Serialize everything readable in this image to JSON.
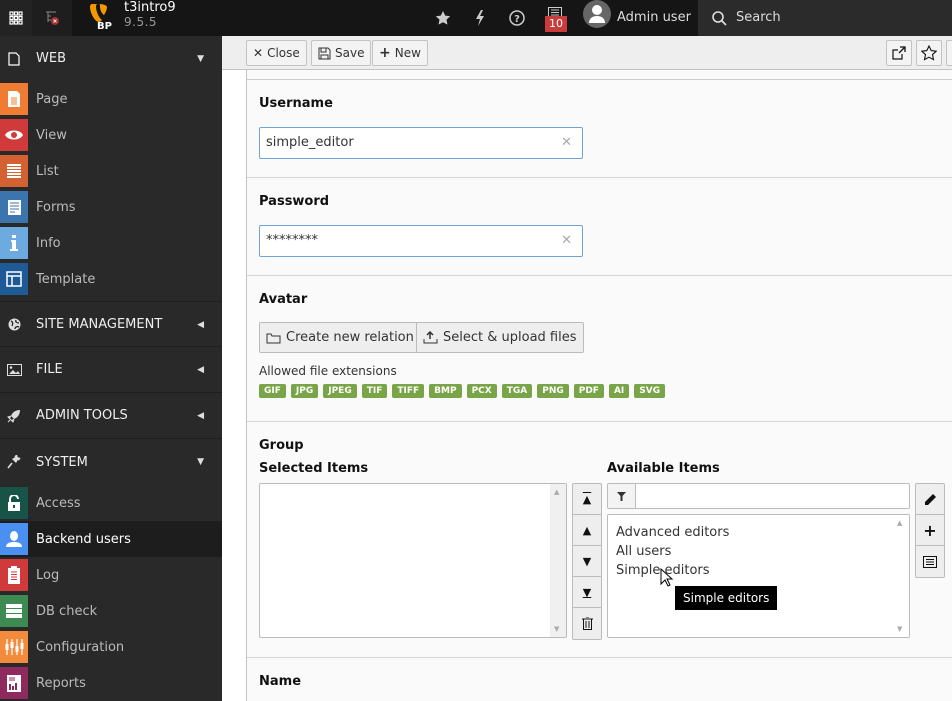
{
  "topbar": {
    "site_name": "t3intro9",
    "version": "9.5.5",
    "logo_text": "BP",
    "notification_count": "10",
    "user_name": "Admin user",
    "search_label": "Search",
    "icons": [
      "modules-grid-icon",
      "page-tree-toggle-icon",
      "bookmark-star-icon",
      "flash-icon",
      "help-icon",
      "system-info-icon"
    ]
  },
  "sidebar": {
    "groups": [
      {
        "label": "WEB",
        "icon": "page-icon",
        "expanded": true,
        "items": [
          {
            "label": "Page",
            "icon": "page-module-icon",
            "color": "#f07c33"
          },
          {
            "label": "View",
            "icon": "eye-icon",
            "color": "#d13a3a"
          },
          {
            "label": "List",
            "icon": "list-icon",
            "color": "#d46132"
          },
          {
            "label": "Forms",
            "icon": "forms-icon",
            "color": "#3c74ae"
          },
          {
            "label": "Info",
            "icon": "info-icon",
            "color": "#6daae0"
          },
          {
            "label": "Template",
            "icon": "template-icon",
            "color": "#1d5a96"
          }
        ]
      },
      {
        "label": "SITE MANAGEMENT",
        "icon": "globe-icon",
        "expanded": false,
        "items": []
      },
      {
        "label": "FILE",
        "icon": "image-icon",
        "expanded": false,
        "items": []
      },
      {
        "label": "ADMIN TOOLS",
        "icon": "rocket-icon",
        "expanded": false,
        "items": []
      },
      {
        "label": "SYSTEM",
        "icon": "plug-icon",
        "expanded": true,
        "items": [
          {
            "label": "Access",
            "icon": "unlock-icon",
            "color": "#175447"
          },
          {
            "label": "Backend users",
            "icon": "user-icon",
            "color": "#4a8ff2",
            "active": true
          },
          {
            "label": "Log",
            "icon": "log-icon",
            "color": "#d13a3a"
          },
          {
            "label": "DB check",
            "icon": "database-icon",
            "color": "#3d8a52"
          },
          {
            "label": "Configuration",
            "icon": "sliders-icon",
            "color": "#f28c3c"
          },
          {
            "label": "Reports",
            "icon": "reports-icon",
            "color": "#8e2a5e"
          }
        ]
      }
    ]
  },
  "docheader": {
    "close_label": "Close",
    "save_label": "Save",
    "new_label": "New"
  },
  "form": {
    "username": {
      "label": "Username",
      "value": "simple_editor"
    },
    "password": {
      "label": "Password",
      "value": "********"
    },
    "avatar": {
      "label": "Avatar",
      "create_label": "Create new relation",
      "upload_label": "Select & upload files",
      "allowed_label": "Allowed file extensions",
      "extensions": [
        "GIF",
        "JPG",
        "JPEG",
        "TIF",
        "TIFF",
        "BMP",
        "PCX",
        "TGA",
        "PNG",
        "PDF",
        "AI",
        "SVG"
      ]
    },
    "group": {
      "label": "Group",
      "selected_label": "Selected Items",
      "available_label": "Available Items",
      "filter_value": "",
      "available_items": [
        "Advanced editors",
        "All users",
        "Simple editors"
      ],
      "tooltip": "Simple editors"
    },
    "name": {
      "label": "Name"
    }
  },
  "colors": {
    "accent_input_border": "#6fa3d5",
    "extension_badge": "#79a548",
    "notification_badge": "#c83c3c"
  }
}
